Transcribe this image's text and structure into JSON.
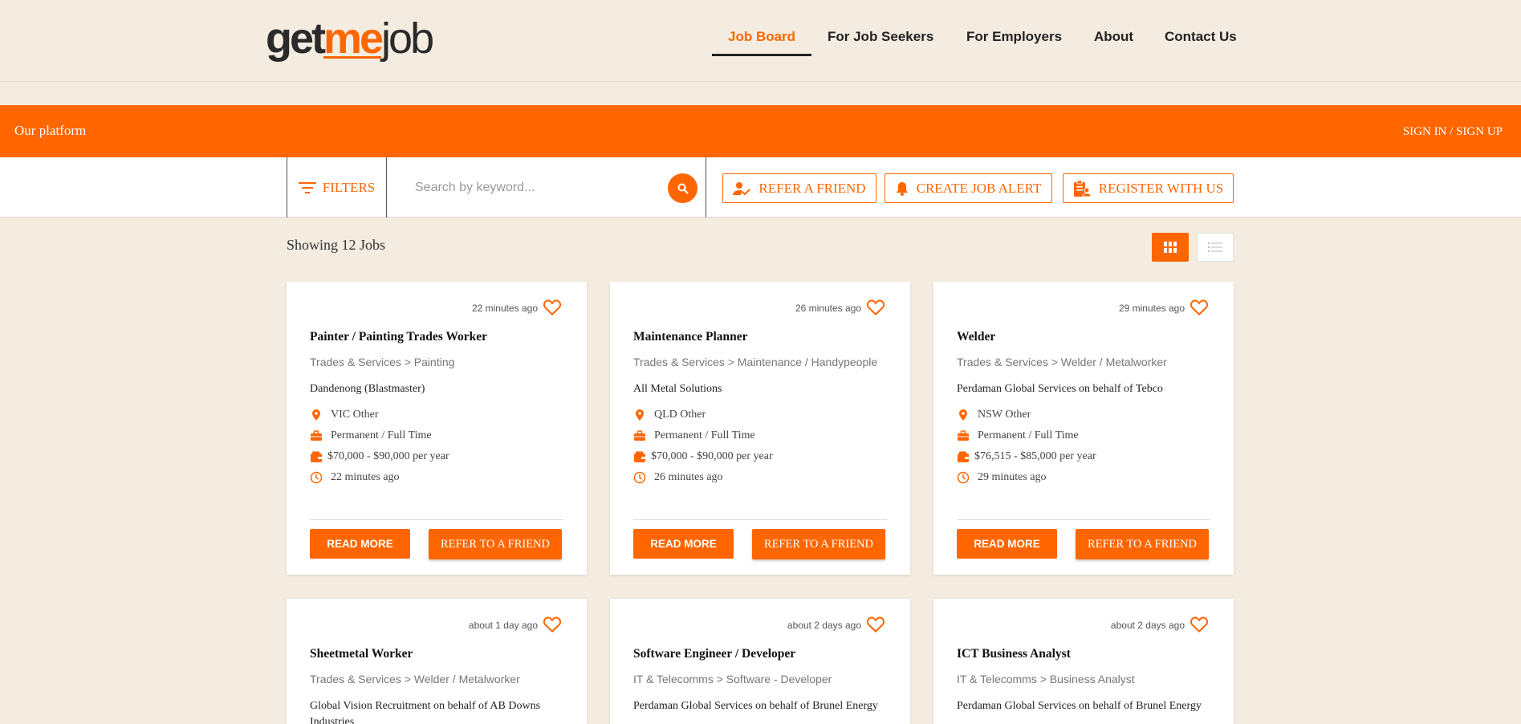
{
  "logo": {
    "part1": "get",
    "part2": "me",
    "part3": "job"
  },
  "nav": {
    "items": [
      {
        "label": "Job Board"
      },
      {
        "label": "For Job Seekers"
      },
      {
        "label": "For Employers"
      },
      {
        "label": "About"
      },
      {
        "label": "Contact Us"
      }
    ]
  },
  "banner": {
    "title": "Our platform",
    "signin": "SIGN IN / SIGN UP"
  },
  "search": {
    "filters_label": "FILTERS",
    "placeholder": "Search by keyword...",
    "refer_label": "REFER A FRIEND",
    "alert_label": "CREATE JOB ALERT",
    "register_label": "REGISTER WITH US"
  },
  "results": {
    "showing": "Showing 12 Jobs"
  },
  "jobs": [
    {
      "ago": "22 minutes ago",
      "title": "Painter / Painting Trades Worker",
      "category": "Trades & Services > Painting",
      "company": "Dandenong (Blastmaster)",
      "location": "VIC Other",
      "type": "Permanent / Full Time",
      "salary": "$70,000 - $90,000 per year",
      "posted": "22 minutes ago",
      "read_more": "READ MORE",
      "refer": "REFER TO A FRIEND"
    },
    {
      "ago": "26 minutes ago",
      "title": "Maintenance Planner",
      "category": "Trades & Services > Maintenance / Handypeople",
      "company": "All Metal Solutions",
      "location": "QLD Other",
      "type": "Permanent / Full Time",
      "salary": "$70,000 - $90,000 per year",
      "posted": "26 minutes ago",
      "read_more": "READ MORE",
      "refer": "REFER TO A FRIEND"
    },
    {
      "ago": "29 minutes ago",
      "title": "Welder",
      "category": "Trades & Services > Welder / Metalworker",
      "company": "Perdaman Global Services on behalf of Tebco",
      "location": "NSW Other",
      "type": "Permanent / Full Time",
      "salary": "$76,515 - $85,000 per year",
      "posted": "29 minutes ago",
      "read_more": "READ MORE",
      "refer": "REFER TO A FRIEND"
    },
    {
      "ago": "about 1 day ago",
      "title": "Sheetmetal Worker",
      "category": "Trades & Services > Welder / Metalworker",
      "company": "Global Vision Recruitment on behalf of AB Downs Industries"
    },
    {
      "ago": "about 2 days ago",
      "title": "Software Engineer / Developer",
      "category": "IT & Telecomms > Software - Developer",
      "company": "Perdaman Global Services on behalf of Brunel Energy"
    },
    {
      "ago": "about 2 days ago",
      "title": "ICT Business Analyst",
      "category": "IT & Telecomms > Business Analyst",
      "company": "Perdaman Global Services on behalf of Brunel Energy"
    }
  ],
  "colors": {
    "accent": "#ff6600",
    "background": "#f4ece0"
  }
}
